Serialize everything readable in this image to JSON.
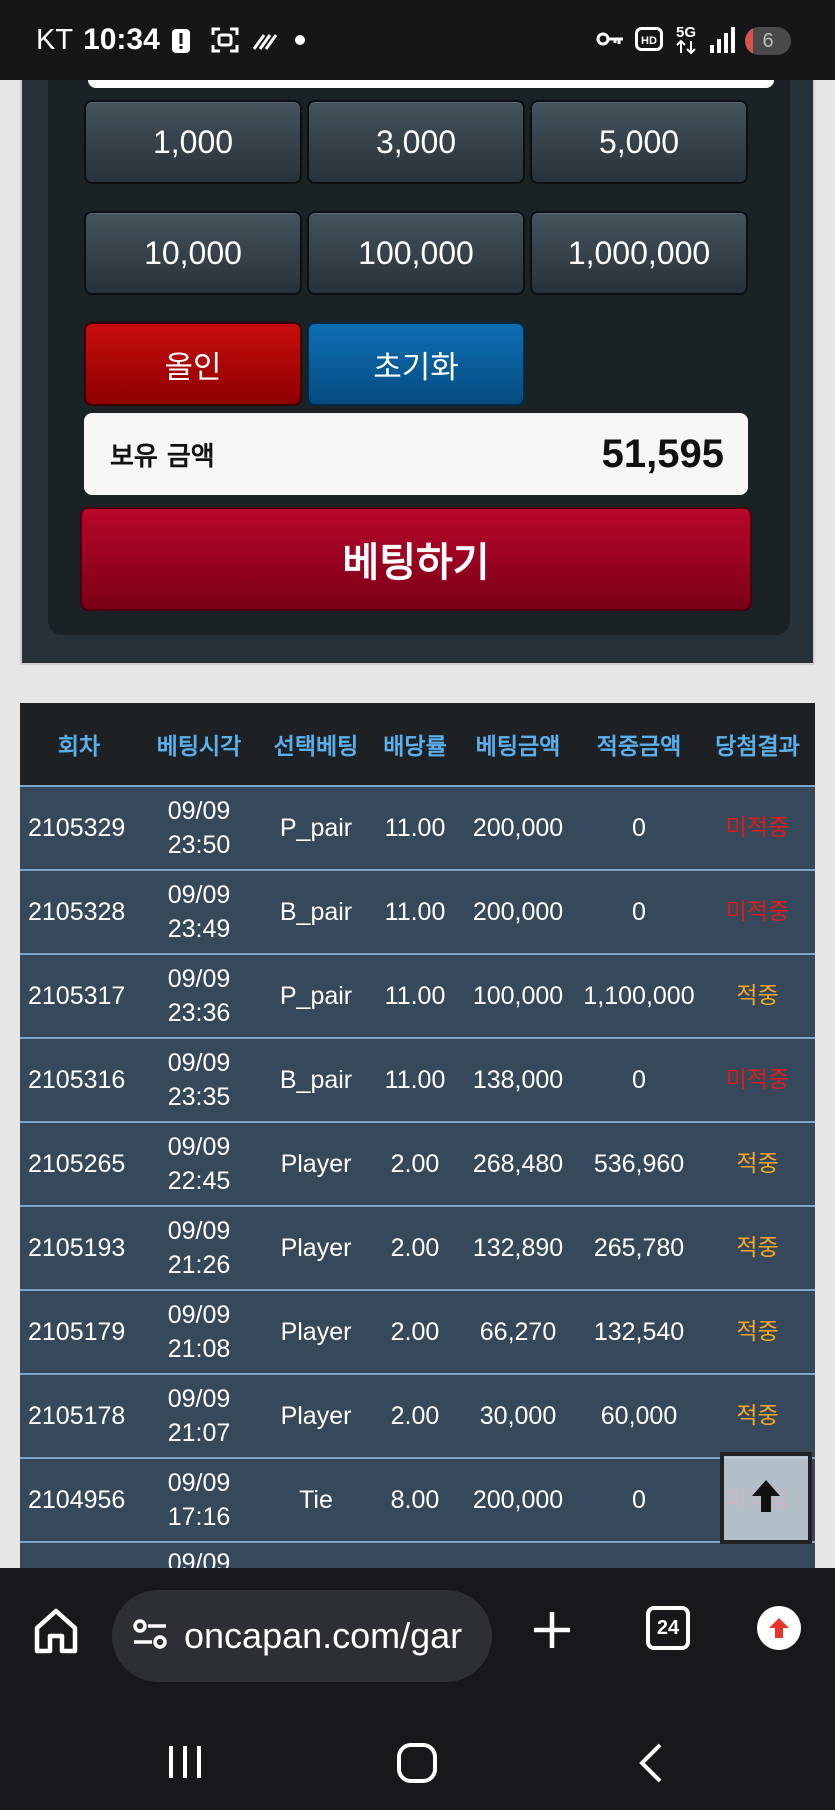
{
  "status_bar": {
    "carrier": "KT",
    "time": "10:34",
    "battery": "6",
    "icons": [
      "alert-icon",
      "screenshot-icon",
      "wifi-calling-icon",
      "dot-icon",
      "key-icon",
      "hd-icon",
      "5g-icon",
      "signal-icon",
      "battery-icon"
    ]
  },
  "chips": [
    "1,000",
    "3,000",
    "5,000",
    "10,000",
    "100,000",
    "1,000,000"
  ],
  "controls": {
    "allin_label": "올인",
    "reset_label": "초기화",
    "balance_label": "보유 금액",
    "balance_value": "51,595",
    "bet_label": "베팅하기"
  },
  "colors": {
    "allin": "#b00000",
    "reset": "#0a5e9a",
    "bet": "#a0001f",
    "win": "#f5a623",
    "loss": "#e01a1a",
    "header_text": "#5bb0ec"
  },
  "history": {
    "headers": [
      "회차",
      "베팅시각",
      "선택베팅",
      "배당률",
      "베팅금액",
      "적중금액",
      "당첨결과"
    ],
    "rows": [
      {
        "round": "2105329",
        "date": "09/09",
        "time": "23:50",
        "pick": "P_pair",
        "odds": "11.00",
        "bet": "200,000",
        "payout": "0",
        "result": "미적중",
        "win": false
      },
      {
        "round": "2105328",
        "date": "09/09",
        "time": "23:49",
        "pick": "B_pair",
        "odds": "11.00",
        "bet": "200,000",
        "payout": "0",
        "result": "미적중",
        "win": false
      },
      {
        "round": "2105317",
        "date": "09/09",
        "time": "23:36",
        "pick": "P_pair",
        "odds": "11.00",
        "bet": "100,000",
        "payout": "1,100,000",
        "result": "적중",
        "win": true
      },
      {
        "round": "2105316",
        "date": "09/09",
        "time": "23:35",
        "pick": "B_pair",
        "odds": "11.00",
        "bet": "138,000",
        "payout": "0",
        "result": "미적중",
        "win": false
      },
      {
        "round": "2105265",
        "date": "09/09",
        "time": "22:45",
        "pick": "Player",
        "odds": "2.00",
        "bet": "268,480",
        "payout": "536,960",
        "result": "적중",
        "win": true
      },
      {
        "round": "2105193",
        "date": "09/09",
        "time": "21:26",
        "pick": "Player",
        "odds": "2.00",
        "bet": "132,890",
        "payout": "265,780",
        "result": "적중",
        "win": true
      },
      {
        "round": "2105179",
        "date": "09/09",
        "time": "21:08",
        "pick": "Player",
        "odds": "2.00",
        "bet": "66,270",
        "payout": "132,540",
        "result": "적중",
        "win": true
      },
      {
        "round": "2105178",
        "date": "09/09",
        "time": "21:07",
        "pick": "Player",
        "odds": "2.00",
        "bet": "30,000",
        "payout": "60,000",
        "result": "적중",
        "win": true
      },
      {
        "round": "2104956",
        "date": "09/09",
        "time": "17:16",
        "pick": "Tie",
        "odds": "8.00",
        "bet": "200,000",
        "payout": "0",
        "result": "미적중",
        "win": false
      }
    ],
    "partial_row_date": "09/09"
  },
  "browser": {
    "url": "oncapan.com/gar",
    "tab_count": "24"
  }
}
